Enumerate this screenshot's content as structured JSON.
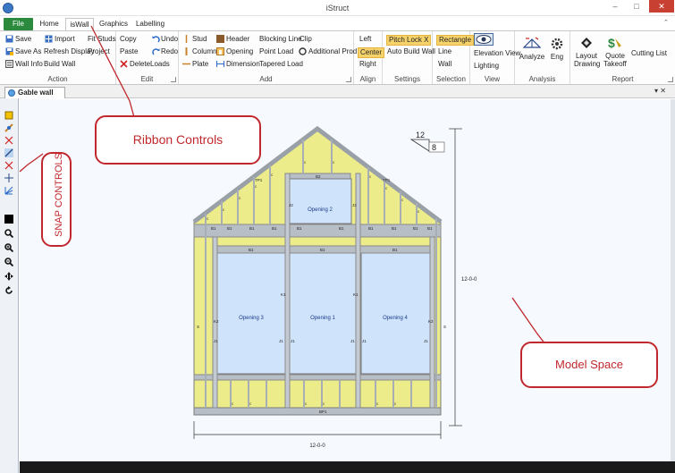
{
  "window": {
    "title": "iStruct",
    "minimize": "–",
    "maximize": "□",
    "close": "✕"
  },
  "tabs": [
    "File",
    "Home",
    "isWall",
    "Graphics",
    "Labelling"
  ],
  "tab_caret": "⌃",
  "ribbon": {
    "action": {
      "label": "Action",
      "save": "Save",
      "save_as": "Save As",
      "wall_info": "Wall Info",
      "import": "Import",
      "refresh_display": "Refresh Display",
      "build_wall": "Build Wall",
      "fit_studs": "Fit Studs",
      "project": "Project"
    },
    "edit": {
      "label": "Edit",
      "copy": "Copy",
      "paste": "Paste",
      "delete": "Delete",
      "undo": "Undo",
      "redo": "Redo",
      "loads": "Loads"
    },
    "add": {
      "label": "Add",
      "stud": "Stud",
      "column": "Column",
      "plate": "Plate",
      "header": "Header",
      "opening": "Opening",
      "dimension": "Dimension",
      "blocking_line": "Blocking Line",
      "point_load": "Point Load",
      "tapered_load": "Tapered Load",
      "clip": "Clip",
      "additional_prod": "Additional Prod."
    },
    "align": {
      "label": "Align",
      "left": "Left",
      "center": "Center",
      "right": "Right"
    },
    "settings": {
      "label": "Settings",
      "pitch_lock": "Pitch Lock X",
      "auto_build_wall": "Auto Build Wall"
    },
    "selection": {
      "label": "Selection",
      "rectangle": "Rectangle",
      "line": "Line",
      "wall": "Wall"
    },
    "view": {
      "label": "View",
      "elevation_view": "Elevation View",
      "lighting": "Lighting"
    },
    "analysis": {
      "label": "Analysis",
      "analyze": "Analyze",
      "eng": "Eng"
    },
    "report": {
      "label": "Report",
      "layout_drawing": "Layout Drawing",
      "quote_takeoff": "Quote Takeoff",
      "cutting_list": "Cutting List"
    }
  },
  "document_tab": {
    "title": "Gable wall",
    "controls": "▾ ✕"
  },
  "drawing": {
    "pitch_run": "12",
    "pitch_rise": "8",
    "width_dim": "12-0-0",
    "height_dim": "12-0-0",
    "openings": [
      "Opening 2",
      "Opening 3",
      "Opening 1",
      "Opening 4"
    ],
    "labels": {
      "bp": "BP1",
      "tp": "TP1",
      "b1": "B1",
      "b2": "B2",
      "j1": "J1",
      "j2": "J2",
      "k1": "K1",
      "k2": "K2",
      "s": "S",
      "c": "c"
    }
  },
  "callouts": {
    "ribbon": "Ribbon Controls",
    "snap": "SNAP CONTROLS",
    "model": "Model Space"
  },
  "colors": {
    "file_tab": "#2b8a3e",
    "callout": "#c0282d",
    "sheathing": "#ecec8a",
    "opening": "#cfe3fa",
    "highlight": "#f6d36a"
  }
}
